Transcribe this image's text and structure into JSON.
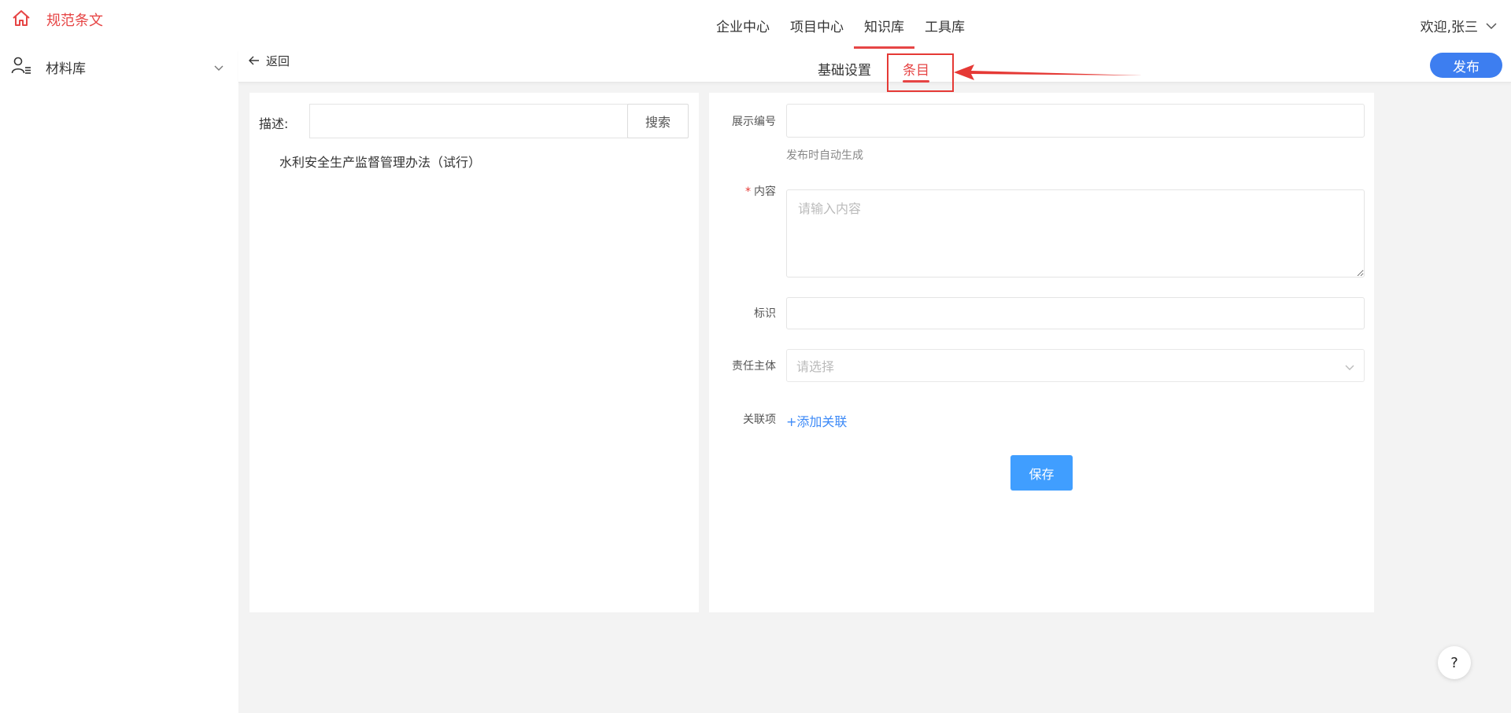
{
  "sidebar": {
    "brand": {
      "label": "规范条文",
      "icon": "home-icon"
    },
    "items": [
      {
        "label": "材料库",
        "icon": "user-list-icon"
      }
    ]
  },
  "topnav": {
    "tabs": [
      {
        "label": "企业中心"
      },
      {
        "label": "项目中心"
      },
      {
        "label": "知识库",
        "active": true
      },
      {
        "label": "工具库"
      }
    ],
    "user": {
      "label": "欢迎,张三"
    }
  },
  "subbar": {
    "back_label": "返回",
    "tabs": [
      {
        "label": "基础设置"
      },
      {
        "label": "条目",
        "active": true
      }
    ],
    "publish_label": "发布"
  },
  "left": {
    "search_label": "描述:",
    "search_value": "",
    "search_button": "搜索",
    "tree": [
      "水利安全生产监督管理办法（试行）"
    ]
  },
  "form": {
    "display_no": {
      "label": "展示编号",
      "value": "",
      "hint": "发布时自动生成"
    },
    "content": {
      "label": "内容",
      "required_mark": "*",
      "placeholder": "请输入内容",
      "value": ""
    },
    "mark": {
      "label": "标识",
      "value": ""
    },
    "responsible": {
      "label": "责任主体",
      "placeholder": "请选择"
    },
    "related": {
      "label": "关联项",
      "add_label": "+添加关联"
    },
    "save_label": "保存"
  },
  "help_label": "?",
  "colors": {
    "accent_red": "#e64545",
    "primary_blue": "#409eff",
    "publish_blue": "#3d7ef0",
    "annotation_red": "#e53935"
  }
}
